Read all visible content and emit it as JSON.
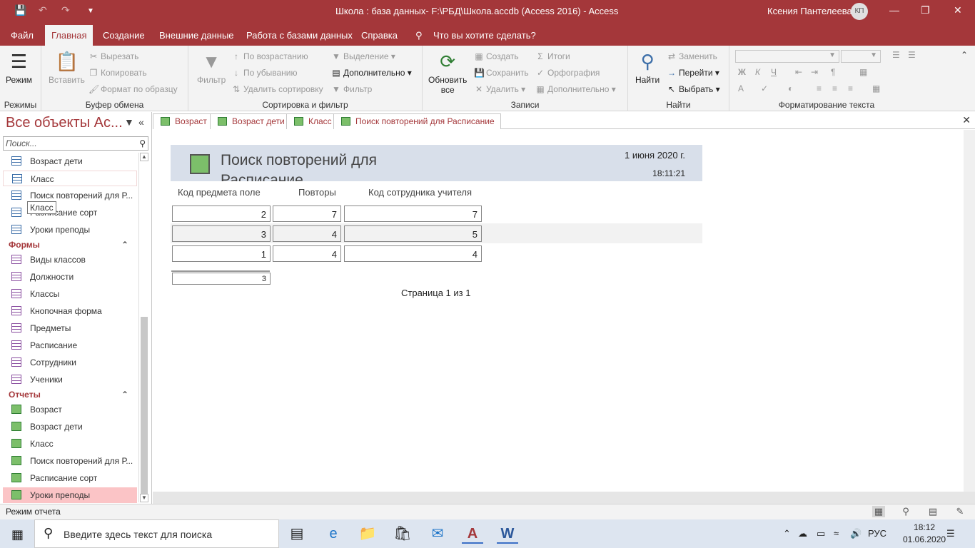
{
  "title": "Школа : база данных- F:\\РБД\\Школа.accdb (Access 2016)  -  Access",
  "user": {
    "name": "Ксения Пантелеева",
    "initials": "КП"
  },
  "ribbon_tabs": [
    "Файл",
    "Главная",
    "Создание",
    "Внешние данные",
    "Работа с базами данных",
    "Справка"
  ],
  "tellme": "Что вы хотите сделать?",
  "ribbon": {
    "modes": {
      "label": "Режим",
      "group": "Режимы"
    },
    "clipboard": {
      "paste": "Вставить",
      "cut": "Вырезать",
      "copy": "Копировать",
      "format": "Формат по образцу",
      "group": "Буфер обмена"
    },
    "sort": {
      "filter": "Фильтр",
      "asc": "По возрастанию",
      "desc": "По убыванию",
      "clear": "Удалить сортировку",
      "selection": "Выделение",
      "advanced": "Дополнительно",
      "toggle": "Фильтр",
      "group": "Сортировка и фильтр"
    },
    "records": {
      "refresh": "Обновить",
      "refresh2": "все",
      "new": "Создать",
      "save": "Сохранить",
      "delete": "Удалить",
      "totals": "Итоги",
      "spelling": "Орфография",
      "more": "Дополнительно",
      "group": "Записи"
    },
    "find": {
      "find": "Найти",
      "replace": "Заменить",
      "goto": "Перейти",
      "select": "Выбрать",
      "group": "Найти"
    },
    "text": {
      "bold": "Ж",
      "italic": "К",
      "underline": "Ч",
      "group": "Форматирование текста"
    }
  },
  "nav": {
    "title": "Все объекты Ac...",
    "search_placeholder": "Поиск...",
    "queries": [
      "Возраст дети",
      "Класс",
      "Поиск повторений для Р...",
      "Расписание сорт",
      "Уроки преподы"
    ],
    "forms_header": "Формы",
    "forms": [
      "Виды классов",
      "Должности",
      "Классы",
      "Кнопочная форма",
      "Предметы",
      "Расписание",
      "Сотрудники",
      "Ученики"
    ],
    "reports_header": "Отчеты",
    "reports": [
      "Возраст",
      "Возраст дети",
      "Класс",
      "Поиск повторений для Р...",
      "Расписание сорт",
      "Уроки преподы"
    ],
    "tooltip": "Класс"
  },
  "doc_tabs": [
    "Возраст",
    "Возраст дети",
    "Класс",
    "Поиск повторений для Расписание"
  ],
  "report": {
    "title": "Поиск повторений для Расписание",
    "date": "1 июня 2020 г.",
    "time": "18:11:21",
    "columns": [
      "Код предмета поле",
      "Повторы",
      "Код сотрудника учителя"
    ],
    "rows": [
      [
        "2",
        "7",
        "7"
      ],
      [
        "3",
        "4",
        "5"
      ],
      [
        "1",
        "4",
        "4"
      ]
    ],
    "total": "3",
    "page": "Страница 1 из 1"
  },
  "status": "Режим отчета",
  "taskbar": {
    "search": "Введите здесь текст для поиска",
    "lang": "РУС",
    "time": "18:12",
    "date": "01.06.2020"
  },
  "colors": {
    "accent": "#a4373a",
    "report_header": "#d8dfea",
    "highlight": "#fbc4c6"
  }
}
